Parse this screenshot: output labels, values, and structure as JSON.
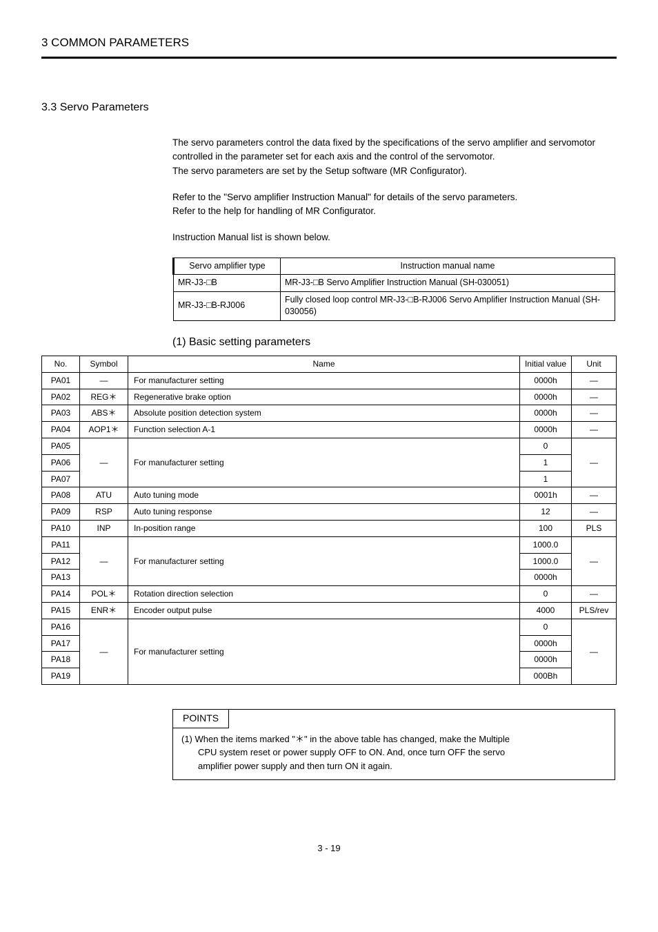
{
  "header": {
    "title": "3  COMMON PARAMETERS"
  },
  "section": {
    "title": "3.3 Servo Parameters"
  },
  "body": {
    "p1": "The servo parameters control the data fixed by the specifications of the servo amplifier and servomotor controlled in the parameter set for each axis and the control of the servomotor.",
    "p2": "The servo parameters are set by the Setup software (MR Configurator).",
    "p3": "Refer to the \"Servo amplifier Instruction Manual\" for details of the servo parameters.",
    "p4": "Refer to the help for handling of MR Configurator.",
    "p5": "Instruction Manual list is shown below."
  },
  "manual_table": {
    "head_type": "Servo amplifier type",
    "head_name": "Instruction manual name",
    "rows": [
      {
        "type": "MR-J3-□B",
        "name": "MR-J3-□B Servo Amplifier Instruction Manual (SH-030051)"
      },
      {
        "type": "MR-J3-□B-RJ006",
        "name": "Fully closed loop control MR-J3-□B-RJ006 Servo Amplifier Instruction Manual (SH-030056)"
      }
    ]
  },
  "subsection": {
    "title": "(1)  Basic setting parameters"
  },
  "param_table": {
    "head": {
      "no": "No.",
      "symbol": "Symbol",
      "name": "Name",
      "initial": "Initial value",
      "unit": "Unit"
    },
    "rows": [
      {
        "no": "PA01",
        "symbol": "—",
        "name": "For manufacturer setting",
        "initial": "0000h",
        "unit": "—"
      },
      {
        "no": "PA02",
        "symbol": "REG＊",
        "name": "Regenerative brake option",
        "initial": "0000h",
        "unit": "—"
      },
      {
        "no": "PA03",
        "symbol": "ABS＊",
        "name": "Absolute position detection system",
        "initial": "0000h",
        "unit": "—"
      },
      {
        "no": "PA04",
        "symbol": "AOP1＊",
        "name": "Function selection A-1",
        "initial": "0000h",
        "unit": "—"
      },
      {
        "no": "PA05",
        "symbol": "",
        "name": "",
        "initial": "0",
        "unit": ""
      },
      {
        "no": "PA06",
        "symbol": "—",
        "name": "For manufacturer setting",
        "initial": "1",
        "unit": "—"
      },
      {
        "no": "PA07",
        "symbol": "",
        "name": "",
        "initial": "1",
        "unit": ""
      },
      {
        "no": "PA08",
        "symbol": "ATU",
        "name": "Auto tuning mode",
        "initial": "0001h",
        "unit": "—"
      },
      {
        "no": "PA09",
        "symbol": "RSP",
        "name": "Auto tuning response",
        "initial": "12",
        "unit": "—"
      },
      {
        "no": "PA10",
        "symbol": "INP",
        "name": "In-position range",
        "initial": "100",
        "unit": "PLS"
      },
      {
        "no": "PA11",
        "symbol": "",
        "name": "",
        "initial": "1000.0",
        "unit": ""
      },
      {
        "no": "PA12",
        "symbol": "—",
        "name": "For manufacturer setting",
        "initial": "1000.0",
        "unit": "—"
      },
      {
        "no": "PA13",
        "symbol": "",
        "name": "",
        "initial": "0000h",
        "unit": ""
      },
      {
        "no": "PA14",
        "symbol": "POL＊",
        "name": "Rotation direction selection",
        "initial": "0",
        "unit": "—"
      },
      {
        "no": "PA15",
        "symbol": "ENR＊",
        "name": "Encoder output pulse",
        "initial": "4000",
        "unit": "PLS/rev"
      },
      {
        "no": "PA16",
        "symbol": "",
        "name": "",
        "initial": "0",
        "unit": ""
      },
      {
        "no": "PA17",
        "symbol": "",
        "name": "",
        "initial": "0000h",
        "unit": ""
      },
      {
        "no": "PA18",
        "symbol": "—",
        "name": "For manufacturer setting",
        "initial": "0000h",
        "unit": "—"
      },
      {
        "no": "PA19",
        "symbol": "",
        "name": "",
        "initial": "000Bh",
        "unit": ""
      }
    ]
  },
  "points": {
    "label": "POINTS",
    "line1": "(1) When the items marked \"＊\" in the above table has changed, make the Multiple",
    "line2": "CPU system reset or power supply OFF to ON. And, once turn OFF the servo",
    "line3": "amplifier power supply and then turn ON it again."
  },
  "page_number": "3 - 19"
}
